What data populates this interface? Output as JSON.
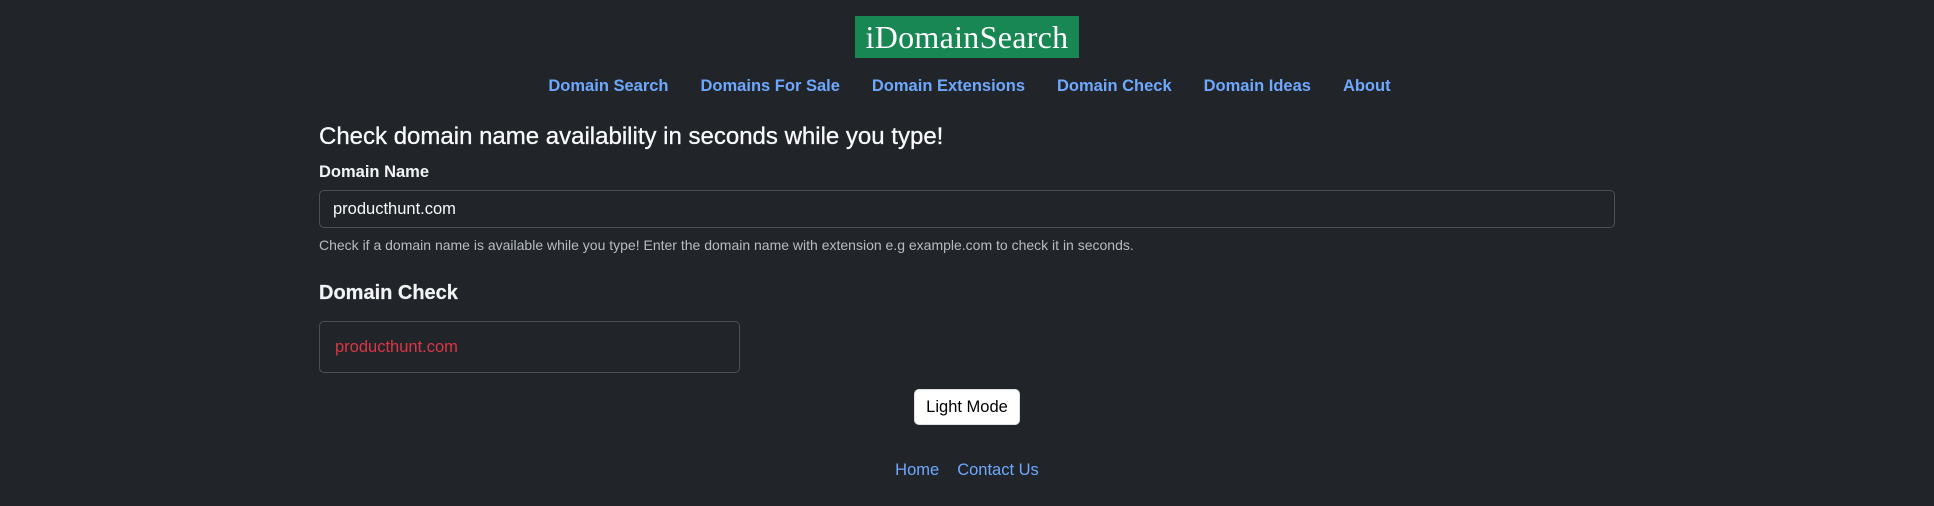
{
  "header": {
    "logo_text": "iDomainSearch"
  },
  "nav": {
    "items": [
      {
        "label": "Domain Search"
      },
      {
        "label": "Domains For Sale"
      },
      {
        "label": "Domain Extensions"
      },
      {
        "label": "Domain Check"
      },
      {
        "label": "Domain Ideas"
      },
      {
        "label": "About"
      }
    ]
  },
  "main": {
    "headline": "Check domain name availability in seconds while you type!",
    "field_label": "Domain Name",
    "input_value": "producthunt.com",
    "help_text": "Check if a domain name is available while you type! Enter the domain name with extension e.g example.com to check it in seconds.",
    "section_title": "Domain Check",
    "results": [
      {
        "domain": "producthunt.com",
        "status_color": "#dc3545"
      }
    ]
  },
  "theme_toggle": {
    "label": "Light Mode"
  },
  "footer": {
    "links": [
      {
        "label": "Home"
      },
      {
        "label": "Contact Us"
      }
    ]
  },
  "colors": {
    "background": "#212529",
    "brand": "#198754",
    "link": "#6ea8fe",
    "unavailable": "#dc3545"
  }
}
